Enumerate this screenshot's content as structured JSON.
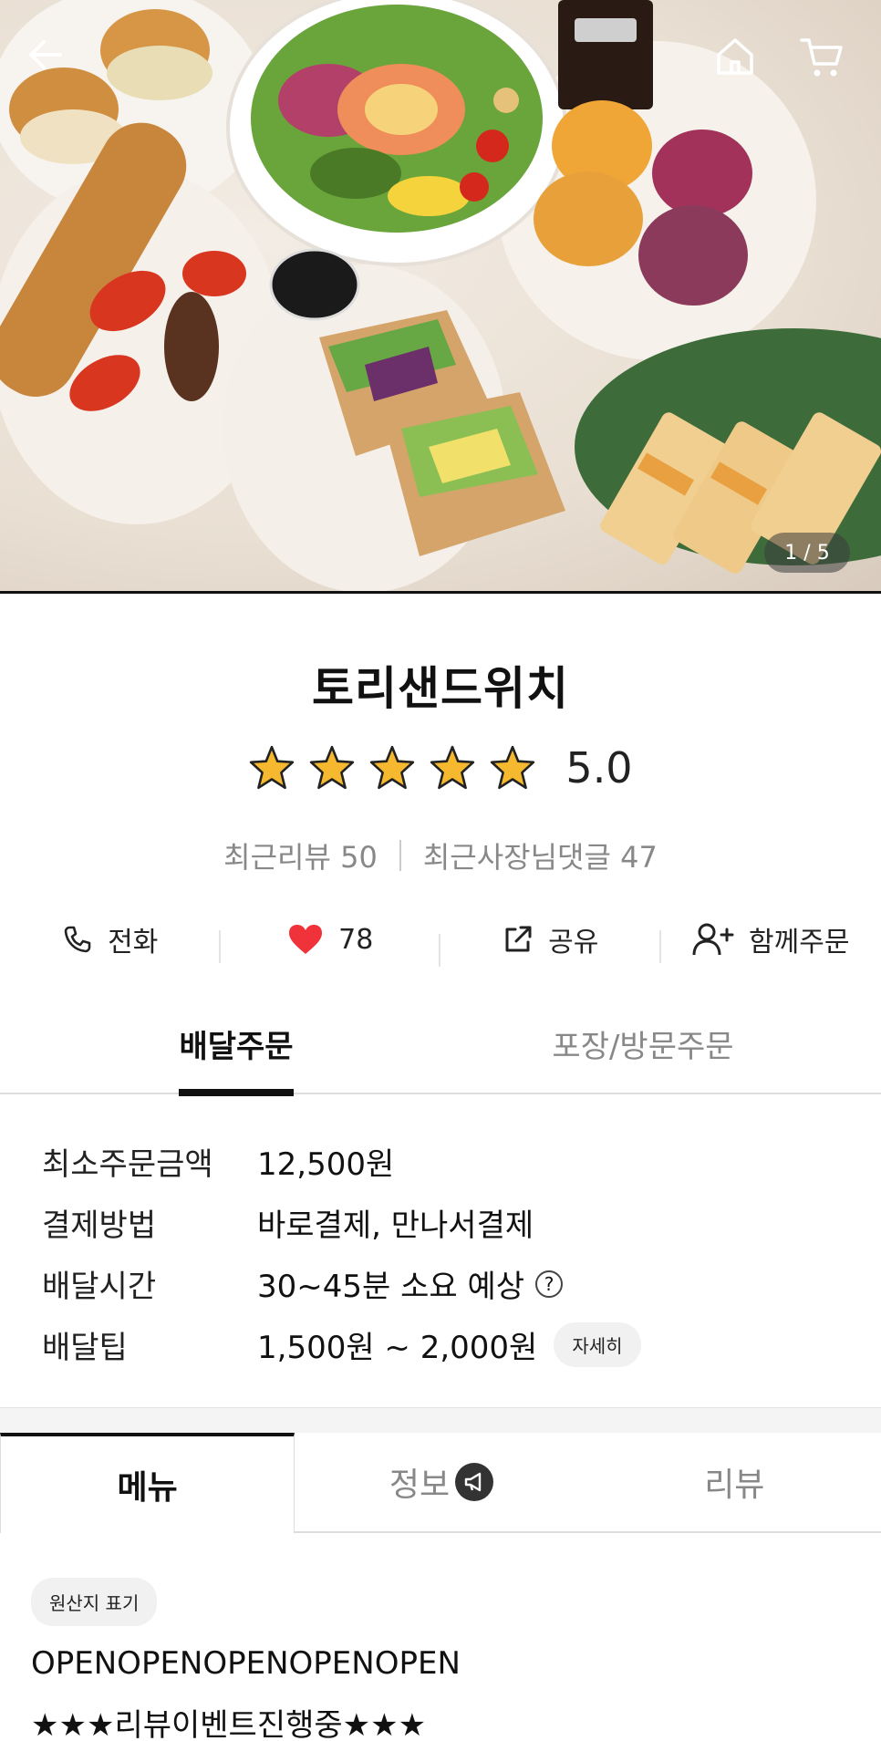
{
  "hero": {
    "counter": "1 / 5"
  },
  "store": {
    "name": "토리샌드위치",
    "rating": "5.0",
    "stars": 5,
    "recent_reviews": "최근리뷰 50",
    "owner_replies": "최근사장님댓글 47"
  },
  "actions": {
    "call": "전화",
    "likes": "78",
    "share": "공유",
    "group_order": "함께주문"
  },
  "order_tabs": {
    "delivery": "배달주문",
    "pickup": "포장/방문주문"
  },
  "info": {
    "min_order_label": "최소주문금액",
    "min_order_value": "12,500원",
    "payment_label": "결제방법",
    "payment_value": "바로결제, 만나서결제",
    "time_label": "배달시간",
    "time_value": "30~45분 소요 예상",
    "tip_label": "배달팁",
    "tip_value": "1,500원 ~ 2,000원",
    "detail": "자세히"
  },
  "menu_tabs": {
    "menu": "메뉴",
    "info": "정보",
    "reviews": "리뷰"
  },
  "content": {
    "origin_label": "원산지 표기",
    "line1": "OPENOPENOPENOPENOPEN",
    "line2": "★★★리뷰이벤트진행중★★★"
  },
  "colors": {
    "star": "#f5b82e",
    "heart": "#f0323a",
    "text": "#111111",
    "muted": "#888888"
  }
}
